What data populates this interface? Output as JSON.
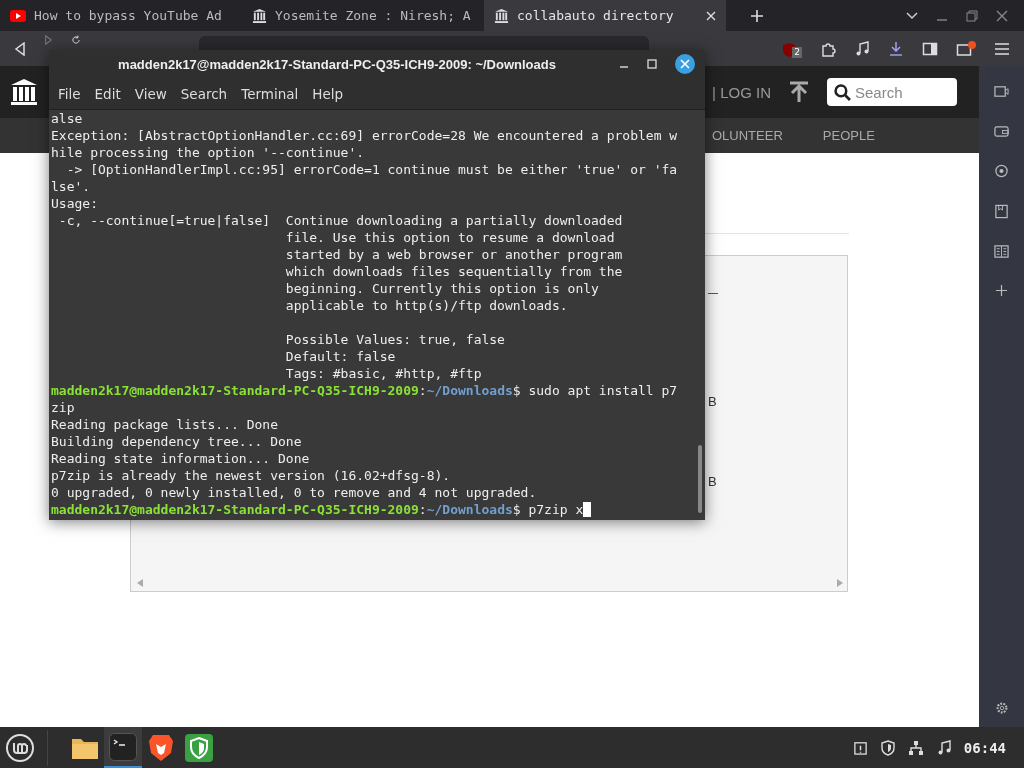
{
  "browser": {
    "tabs": [
      {
        "title": "How to bypass YouTube Ad",
        "kind": "youtube",
        "selected": false
      },
      {
        "title": "Yosemite Zone : Niresh; A",
        "kind": "archive",
        "selected": false
      },
      {
        "title": "collabauto directory",
        "kind": "archive",
        "selected": true
      }
    ],
    "shield_count": "2"
  },
  "page": {
    "header": {
      "login": "| LOG IN",
      "search": {
        "placeholder": "Search"
      }
    },
    "nav": [
      "OLUNTEER",
      "PEOPLE"
    ],
    "listing_fragments": [
      "B",
      "B"
    ]
  },
  "terminal": {
    "title": "madden2k17@madden2k17-Standard-PC-Q35-ICH9-2009: ~/Downloads",
    "menu": [
      "File",
      "Edit",
      "View",
      "Search",
      "Terminal",
      "Help"
    ],
    "lines": [
      {
        "kind": "output",
        "text": "alse"
      },
      {
        "kind": "output",
        "text": "Exception: [AbstractOptionHandler.cc:69] errorCode=28 We encountered a problem w"
      },
      {
        "kind": "output",
        "text": "hile processing the option '--continue'."
      },
      {
        "kind": "output",
        "text": "  -> [OptionHandlerImpl.cc:95] errorCode=1 continue must be either 'true' or 'fa"
      },
      {
        "kind": "output",
        "text": "lse'."
      },
      {
        "kind": "output",
        "text": "Usage:"
      },
      {
        "kind": "output",
        "text": " -c, --continue[=true|false]  Continue downloading a partially downloaded"
      },
      {
        "kind": "output",
        "text": "                              file. Use this option to resume a download"
      },
      {
        "kind": "output",
        "text": "                              started by a web browser or another program"
      },
      {
        "kind": "output",
        "text": "                              which downloads files sequentially from the"
      },
      {
        "kind": "output",
        "text": "                              beginning. Currently this option is only"
      },
      {
        "kind": "output",
        "text": "                              applicable to http(s)/ftp downloads."
      },
      {
        "kind": "blank"
      },
      {
        "kind": "output",
        "text": "                              Possible Values: true, false"
      },
      {
        "kind": "output",
        "text": "                              Default: false"
      },
      {
        "kind": "output",
        "text": "                              Tags: #basic, #http, #ftp"
      },
      {
        "kind": "prompt",
        "user": "madden2k17@madden2k17-Standard-PC-Q35-ICH9-2009",
        "sep": ":",
        "path": "~/Downloads",
        "command": "$ sudo apt install p7",
        "cursor": false
      },
      {
        "kind": "output",
        "text": "zip"
      },
      {
        "kind": "output",
        "text": "Reading package lists... Done"
      },
      {
        "kind": "output",
        "text": "Building dependency tree... Done"
      },
      {
        "kind": "output",
        "text": "Reading state information... Done"
      },
      {
        "kind": "output",
        "text": "p7zip is already the newest version (16.02+dfsg-8)."
      },
      {
        "kind": "output",
        "text": "0 upgraded, 0 newly installed, 0 to remove and 4 not upgraded."
      },
      {
        "kind": "prompt",
        "user": "madden2k17@madden2k17-Standard-PC-Q35-ICH9-2009",
        "sep": ":",
        "path": "~/Downloads",
        "command": "$ p7zip x",
        "cursor": true
      }
    ]
  },
  "taskbar": {
    "apps": [
      {
        "kind": "files",
        "active": false
      },
      {
        "kind": "terminal",
        "active": true
      },
      {
        "kind": "brave",
        "active": false
      },
      {
        "kind": "vpn",
        "active": false
      }
    ],
    "clock": "06:44"
  }
}
